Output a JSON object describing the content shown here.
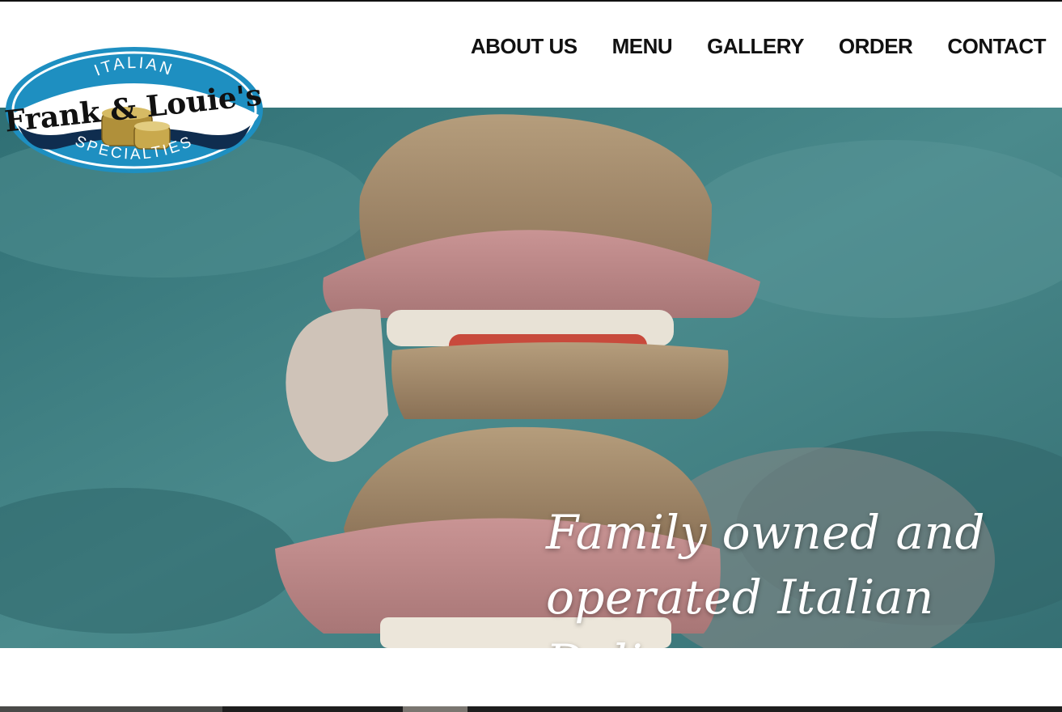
{
  "brand": {
    "arc_top": "ITALIAN",
    "name": "Frank & Louie's",
    "arc_bottom": "SPECIALTIES"
  },
  "nav": {
    "items": [
      {
        "label": "ABOUT US"
      },
      {
        "label": "MENU"
      },
      {
        "label": "GALLERY"
      },
      {
        "label": "ORDER"
      },
      {
        "label": "CONTACT"
      }
    ]
  },
  "hero": {
    "tagline_line1": "Family owned and",
    "tagline_line2": "operated Italian Deli",
    "image": "sandwich-photo"
  },
  "colors": {
    "logo_blue": "#1e8fc1",
    "logo_navy": "#0f2d4f",
    "logo_gold": "#b0903a",
    "hero_teal": "#3f7e82",
    "text_dark": "#111111"
  }
}
